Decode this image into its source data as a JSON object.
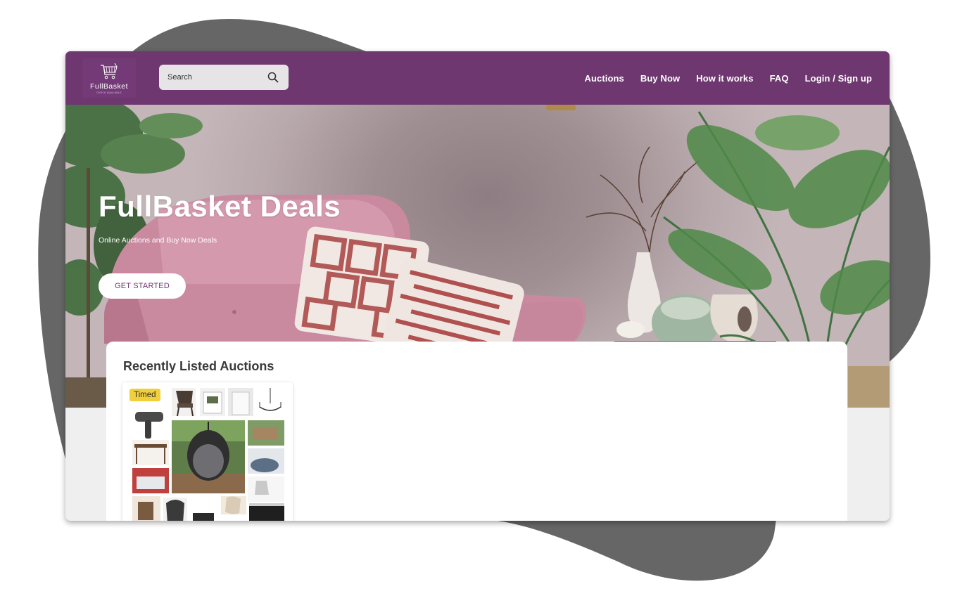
{
  "logo": {
    "name": "FullBasket",
    "tagline": "CHECK AVAILABLE",
    "icon": "shopping-cart-icon"
  },
  "search": {
    "placeholder": "Search",
    "value": "",
    "icon": "search-icon"
  },
  "nav": {
    "auctions": "Auctions",
    "buy_now": "Buy Now",
    "how_it_works": "How it works",
    "faq": "FAQ",
    "login": "Login / Sign up"
  },
  "hero": {
    "title": "FullBasket Deals",
    "subtitle": "Online Auctions and Buy Now Deals",
    "cta": "GET STARTED"
  },
  "recent": {
    "title": "Recently Listed Auctions",
    "badge": "Timed"
  },
  "colors": {
    "brand_purple": "#6e3770",
    "page_bg": "#efefef",
    "badge_yellow": "#f1cf3c",
    "backdrop_blob": "#666666"
  }
}
